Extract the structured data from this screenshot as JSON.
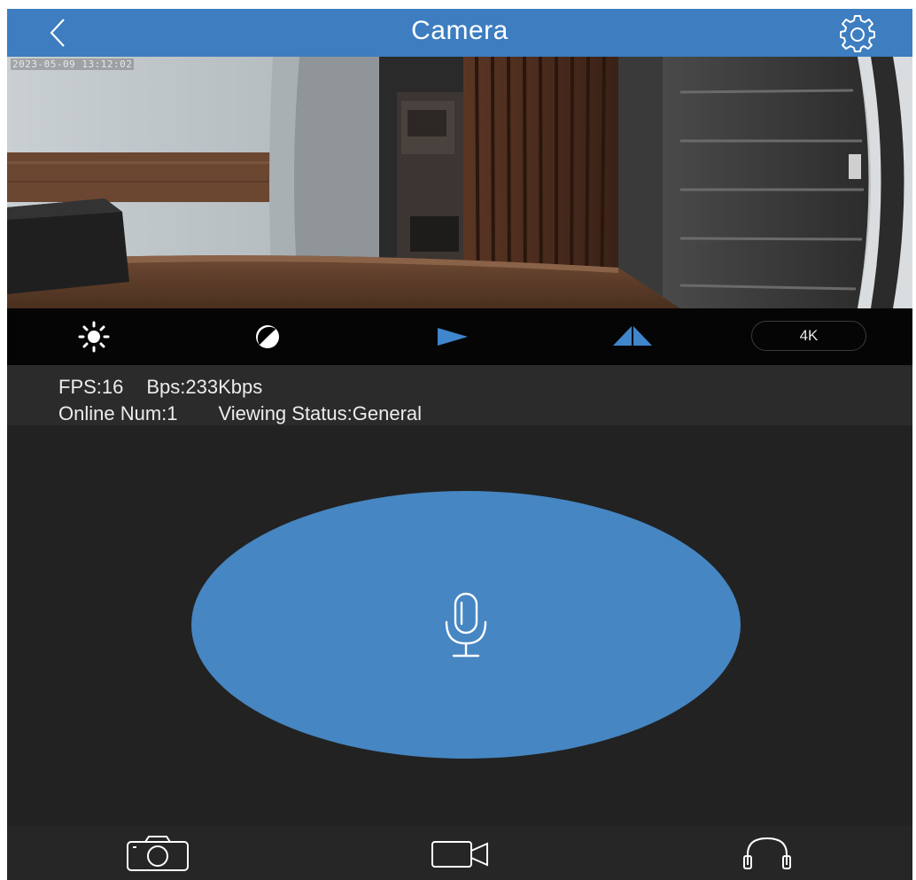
{
  "header": {
    "title": "Camera",
    "back_icon": "chevron-left-icon",
    "settings_icon": "gear-icon"
  },
  "video": {
    "timestamp": "2023-05-09 13:12:02"
  },
  "controls": {
    "items": [
      {
        "icon": "brightness-icon"
      },
      {
        "icon": "contrast-icon"
      },
      {
        "icon": "flip-horizontal-icon"
      },
      {
        "icon": "flip-vertical-icon"
      }
    ],
    "quality_label": "4K"
  },
  "stats": {
    "fps": "FPS:16",
    "bps": "Bps:233Kbps",
    "online": "Online Num:1",
    "viewing_status": "Viewing Status:General"
  },
  "talk": {
    "icon": "microphone-icon"
  },
  "bottom_bar": {
    "items": [
      {
        "icon": "camera-snapshot-icon"
      },
      {
        "icon": "video-record-icon"
      },
      {
        "icon": "headphones-icon"
      }
    ]
  },
  "colors": {
    "accent": "#3d7dc0",
    "talk_button": "#4686c2",
    "background": "#222222"
  }
}
